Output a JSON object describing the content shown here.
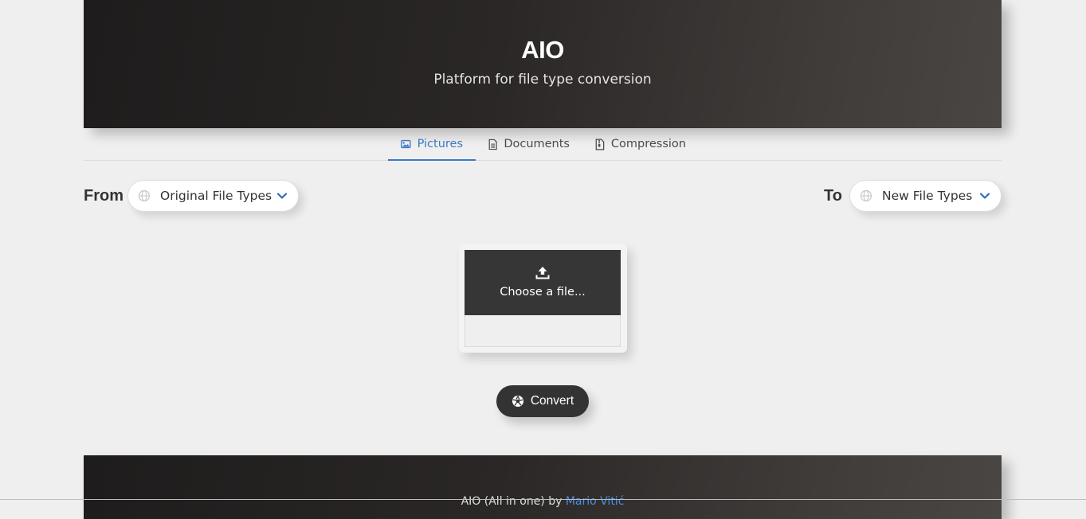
{
  "hero": {
    "title": "AIO",
    "subtitle": "Platform for file type conversion"
  },
  "tabs": [
    {
      "label": "Pictures",
      "icon": "image-icon",
      "active": true
    },
    {
      "label": "Documents",
      "icon": "document-icon",
      "active": false
    },
    {
      "label": "Compression",
      "icon": "zip-file-icon",
      "active": false
    }
  ],
  "from": {
    "label": "From",
    "select_value": "Original File Types",
    "icon": "globe-icon"
  },
  "to": {
    "label": "To",
    "select_value": "New File Types",
    "icon": "globe-icon"
  },
  "upload": {
    "label": "Choose a file...",
    "icon": "upload-icon",
    "file_name": ""
  },
  "convert": {
    "label": "Convert",
    "icon": "aperture-icon"
  },
  "footer": {
    "text": "AIO (All in one) by ",
    "link": "Mario Vitić"
  },
  "colors": {
    "accent": "#3b78c4",
    "hero_bg": "#2a2726",
    "button_bg": "#333333",
    "page_bg": "#efefef"
  }
}
